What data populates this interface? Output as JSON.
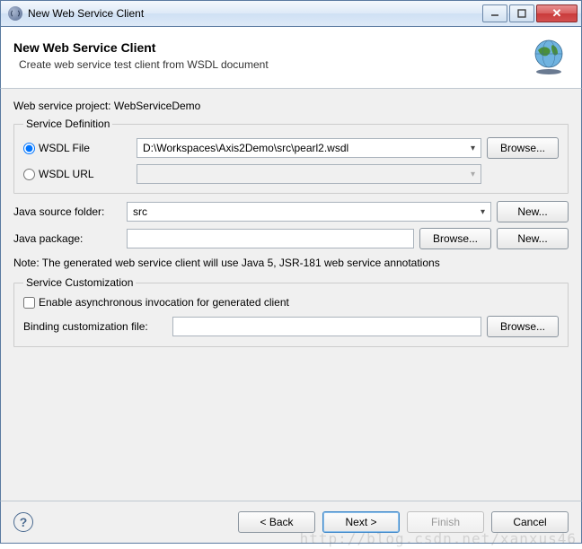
{
  "window": {
    "title": "New Web Service Client"
  },
  "banner": {
    "heading": "New Web Service Client",
    "subheading": "Create web service test client from WSDL document"
  },
  "project": {
    "label": "Web service project:",
    "value": "WebServiceDemo"
  },
  "serviceDefinition": {
    "legend": "Service Definition",
    "wsdlFileLabel": "WSDL File",
    "wsdlFileValue": "D:\\Workspaces\\Axis2Demo\\src\\pearl2.wsdl",
    "wsdlUrlLabel": "WSDL URL",
    "wsdlUrlValue": "",
    "browse": "Browse...",
    "selectedSource": "file"
  },
  "javaSource": {
    "label": "Java source folder:",
    "value": "src",
    "newLabel": "New..."
  },
  "javaPackage": {
    "label": "Java package:",
    "value": "",
    "browse": "Browse...",
    "newLabel": "New..."
  },
  "note": "Note: The generated web service client will use Java 5, JSR-181 web service annotations",
  "serviceCustomization": {
    "legend": "Service Customization",
    "enableAsyncLabel": "Enable asynchronous invocation for generated client",
    "enableAsyncChecked": false,
    "bindingLabel": "Binding customization file:",
    "bindingValue": "",
    "browse": "Browse..."
  },
  "footer": {
    "back": "< Back",
    "next": "Next >",
    "finish": "Finish",
    "cancel": "Cancel"
  },
  "watermark": "http://blog.csdn.net/xanxus46"
}
